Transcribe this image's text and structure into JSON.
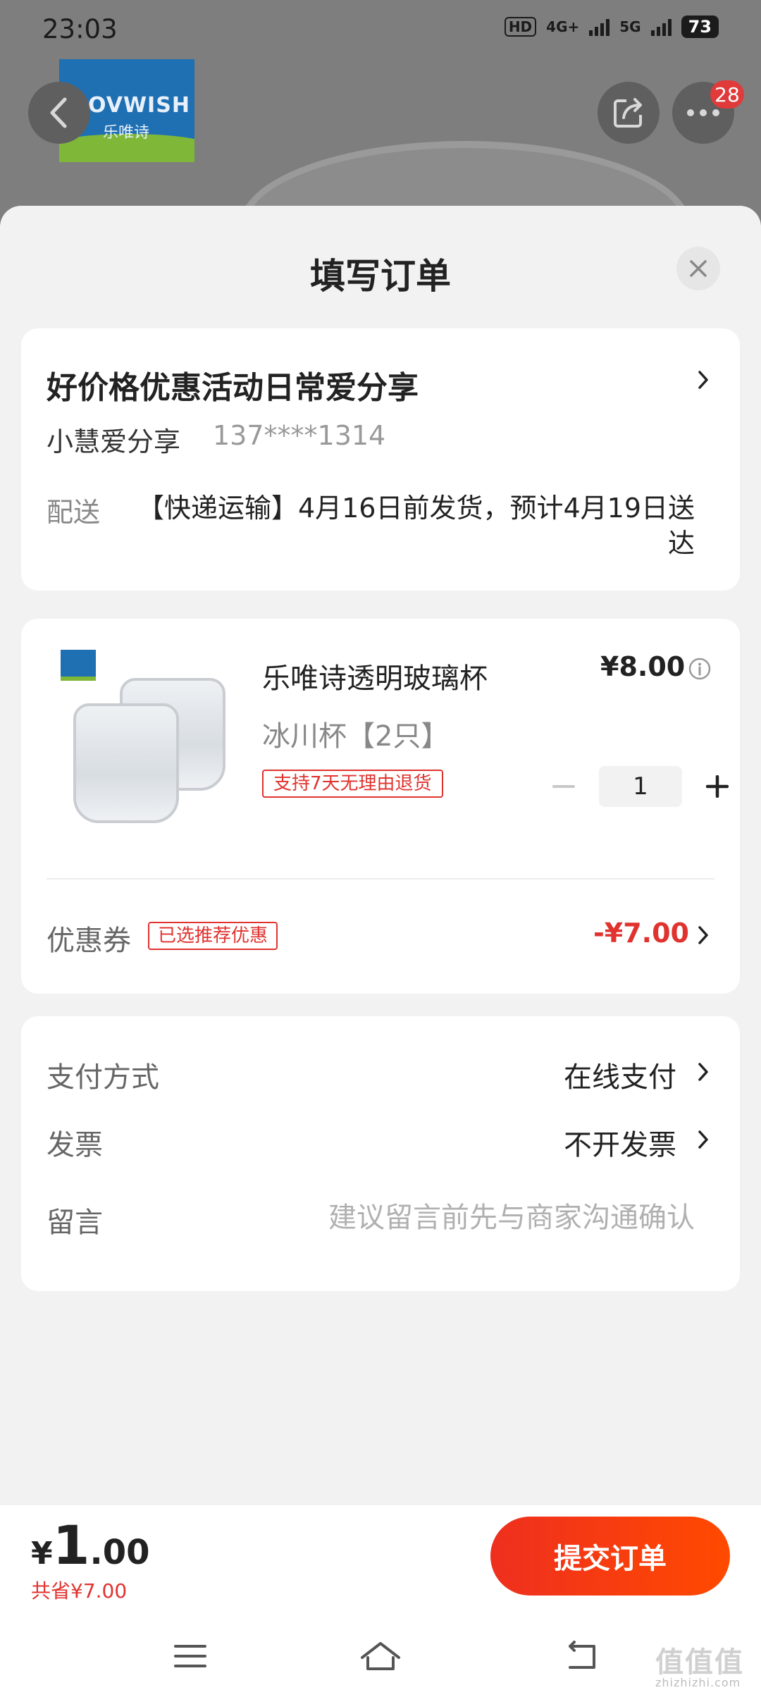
{
  "status_bar": {
    "time": "23:03",
    "hd": "HD",
    "network_4g": "4G+",
    "network_5g": "5G",
    "battery": "73"
  },
  "background_page": {
    "brand_logo_latin": "LOVWISH",
    "brand_logo_cn": "乐唯诗",
    "more_badge": "28"
  },
  "sheet": {
    "title": "填写订单"
  },
  "address": {
    "title": "好价格优惠活动日常爱分享",
    "name": "小慧爱分享",
    "phone": "137****1314",
    "delivery_label": "配送",
    "delivery_text": "【快递运输】4月16日前发货，预计4月19日送达"
  },
  "product": {
    "name": "乐唯诗透明玻璃杯",
    "spec": "冰川杯【2只】",
    "return_tag": "支持7天无理由退货",
    "price": "¥8.00",
    "quantity": "1",
    "coupon_label": "优惠券",
    "coupon_tag": "已选推荐优惠",
    "coupon_value": "-¥7.00"
  },
  "payment": {
    "method_label": "支付方式",
    "method_value": "在线支付",
    "invoice_label": "发票",
    "invoice_value": "不开发票",
    "message_label": "留言",
    "message_placeholder": "建议留言前先与商家沟通确认"
  },
  "footer": {
    "currency": "¥",
    "total_int": "1",
    "total_dec": ".00",
    "saved": "共省¥7.00",
    "submit": "提交订单"
  },
  "watermark": {
    "text": "值值值",
    "url": "zhizhizhi.com"
  },
  "colors": {
    "accent": "#e0332f",
    "button_start": "#ee2f1f",
    "button_end": "#ff4a00"
  }
}
